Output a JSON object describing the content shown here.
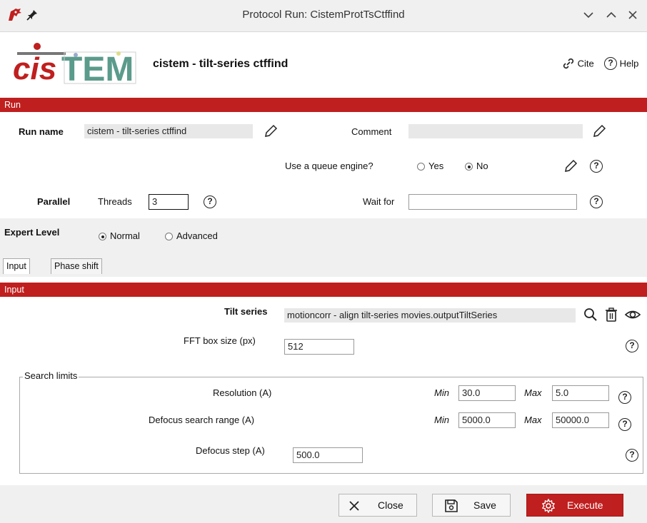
{
  "window": {
    "title": "Protocol Run: CistemProtTsCtffind",
    "minimize_icon": "chevron-down",
    "maximize_icon": "chevron-up",
    "close_icon": "x"
  },
  "header": {
    "logo_text": "cisTEM",
    "protocol_title": "cistem - tilt-series ctffind",
    "cite_label": "Cite",
    "help_label": "Help"
  },
  "run_section": {
    "bar_label": "Run",
    "run_name_label": "Run name",
    "run_name_value": "cistem - tilt-series ctffind",
    "comment_label": "Comment",
    "comment_value": "",
    "queue_label": "Use a queue engine?",
    "queue_yes": "Yes",
    "queue_no": "No",
    "queue_selected": "No",
    "parallel_label": "Parallel",
    "threads_label": "Threads",
    "threads_value": "3",
    "wait_for_label": "Wait for",
    "wait_for_value": ""
  },
  "expert": {
    "label": "Expert Level",
    "normal": "Normal",
    "advanced": "Advanced",
    "selected": "Normal"
  },
  "tabs": [
    {
      "label": "Input",
      "active": true
    },
    {
      "label": "Phase shift",
      "active": false
    }
  ],
  "input_section": {
    "bar_label": "Input",
    "tilt_series_label": "Tilt series",
    "tilt_series_value": "motioncorr - align tilt-series movies.outputTiltSeries",
    "fft_label": "FFT box size (px)",
    "fft_value": "512"
  },
  "search_limits": {
    "legend": "Search limits",
    "min_label": "Min",
    "max_label": "Max",
    "resolution_label": "Resolution (A)",
    "resolution_min": "30.0",
    "resolution_max": "5.0",
    "defocus_range_label": "Defocus search range (A)",
    "defocus_min": "5000.0",
    "defocus_max": "50000.0",
    "defocus_step_label": "Defocus step (A)",
    "defocus_step_value": "500.0"
  },
  "buttons": {
    "close": "Close",
    "save": "Save",
    "execute": "Execute"
  },
  "colors": {
    "accent_red": "#c01f1f",
    "band_gray": "#f0f0f0"
  }
}
